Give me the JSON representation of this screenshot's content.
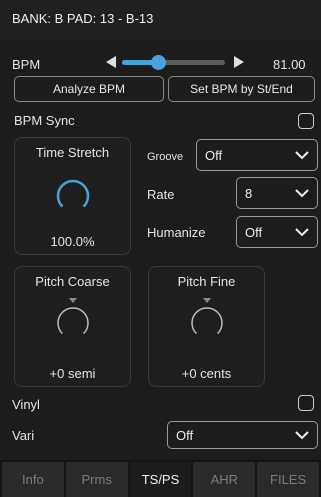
{
  "header": {
    "title": "BANK: B PAD: 13 - B-13"
  },
  "bpm": {
    "label": "BPM",
    "value": "81.00",
    "slider_fraction": 0.35
  },
  "buttons": {
    "analyze": "Analyze BPM",
    "set_bpm": "Set BPM by St/End"
  },
  "bpm_sync": {
    "label": "BPM Sync",
    "checked": false
  },
  "time_stretch": {
    "title": "Time Stretch",
    "value": "100.0%"
  },
  "groove": {
    "label": "Groove",
    "value": "Off"
  },
  "rate": {
    "label": "Rate",
    "value": "8"
  },
  "humanize": {
    "label": "Humanize",
    "value": "Off"
  },
  "pitch_coarse": {
    "title": "Pitch Coarse",
    "value": "+0 semi"
  },
  "pitch_fine": {
    "title": "Pitch Fine",
    "value": "+0 cents"
  },
  "vinyl": {
    "label": "Vinyl",
    "checked": false
  },
  "vari": {
    "label": "Vari",
    "value": "Off"
  },
  "tabs": [
    {
      "label": "Info",
      "active": false
    },
    {
      "label": "Prms",
      "active": false
    },
    {
      "label": "TS/PS",
      "active": true
    },
    {
      "label": "AHR",
      "active": false
    },
    {
      "label": "FILES",
      "active": false
    }
  ],
  "colors": {
    "accent": "#4aa3d8",
    "background": "#1c1c1c"
  }
}
